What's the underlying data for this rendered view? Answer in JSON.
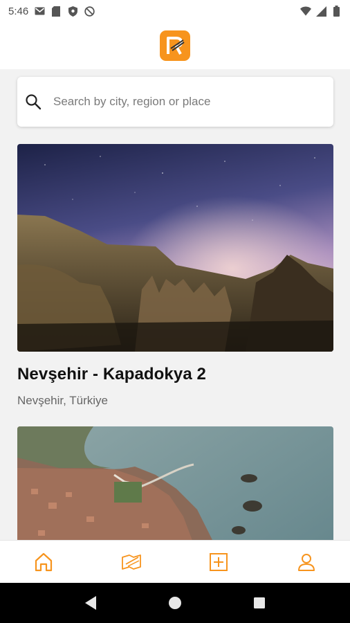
{
  "status_bar": {
    "time": "5:46",
    "left_icons": [
      "gmail-icon",
      "sd-card-icon",
      "shield-icon",
      "at-sign-icon"
    ],
    "right_icons": [
      "wifi-icon",
      "signal-icon",
      "battery-icon"
    ]
  },
  "header": {
    "logo_icon": "app-logo-icon",
    "brand_color": "#f7941d"
  },
  "search": {
    "placeholder": "Search by city, region or place",
    "value": ""
  },
  "cards": [
    {
      "title": "Nevşehir - Kapadokya 2",
      "subtitle": "Nevşehir, Türkiye",
      "image": "cappadocia-night-photo"
    },
    {
      "title": "",
      "subtitle": "",
      "image": "coastal-town-aerial-photo"
    }
  ],
  "bottom_nav": {
    "items": [
      "home-icon",
      "map-pin-icon",
      "add-icon",
      "profile-icon"
    ],
    "active": "home-icon",
    "active_color": "#f7941d"
  },
  "system_nav": [
    "back-icon",
    "home-circle-icon",
    "recents-icon"
  ]
}
